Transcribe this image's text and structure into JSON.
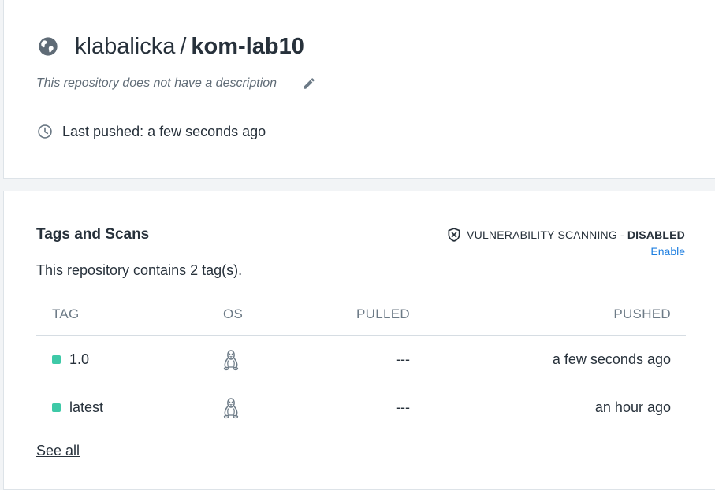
{
  "repo": {
    "namespace": "klabalicka",
    "separator": "/",
    "name": "kom-lab10",
    "description": "This repository does not have a description",
    "last_pushed": "Last pushed: a few seconds ago"
  },
  "tags_section": {
    "heading": "Tags and Scans",
    "vuln_label": "VULNERABILITY SCANNING",
    "vuln_dash": "-",
    "vuln_status": "DISABLED",
    "enable_label": "Enable",
    "tag_count_text": "This repository contains 2 tag(s).",
    "columns": {
      "tag": "TAG",
      "os": "OS",
      "pulled": "PULLED",
      "pushed": "PUSHED"
    },
    "rows": [
      {
        "tag": "1.0",
        "os_icon": "linux-icon",
        "pulled": "---",
        "pushed": "a few seconds ago"
      },
      {
        "tag": "latest",
        "os_icon": "linux-icon",
        "pulled": "---",
        "pushed": "an hour ago"
      }
    ],
    "see_all_label": "See all"
  },
  "colors": {
    "accent_link": "#1f7fe0",
    "tag_status": "#3ec9a7",
    "text_primary": "#27313b",
    "text_muted": "#6c7a86"
  }
}
